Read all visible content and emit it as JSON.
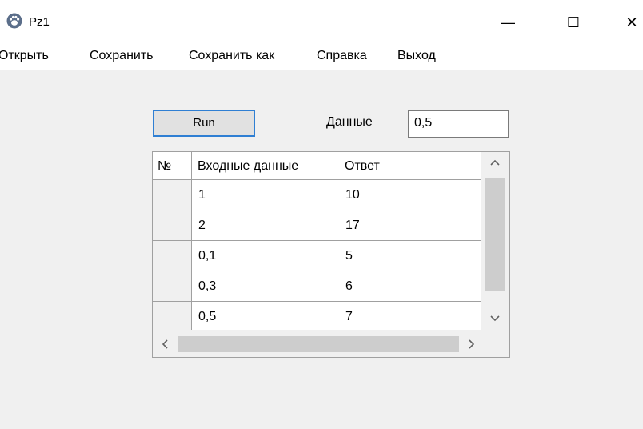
{
  "window": {
    "title": "Pz1",
    "controls": {
      "minimize": "—",
      "maximize": "☐",
      "close": "✕"
    }
  },
  "menu": {
    "items": [
      {
        "label": "Открыть"
      },
      {
        "label": "Сохранить"
      },
      {
        "label": "Сохранить как"
      },
      {
        "label": "Справка"
      },
      {
        "label": "Выход"
      }
    ]
  },
  "form": {
    "run_label": "Run",
    "data_label": "Данные",
    "data_value": "0,5"
  },
  "table": {
    "columns": [
      "№",
      "Входные данные",
      "Ответ"
    ],
    "rows": [
      {
        "n": "",
        "input": "1",
        "answer": "10"
      },
      {
        "n": "",
        "input": "2",
        "answer": "17"
      },
      {
        "n": "",
        "input": "0,1",
        "answer": "5"
      },
      {
        "n": "",
        "input": "0,3",
        "answer": "6"
      },
      {
        "n": "",
        "input": "0,5",
        "answer": "7"
      }
    ]
  },
  "icons": {
    "app": "paw-icon",
    "scroll_up": "chevron-up-icon",
    "scroll_down": "chevron-down-icon",
    "scroll_left": "chevron-left-icon",
    "scroll_right": "chevron-right-icon"
  },
  "colors": {
    "focus_border": "#2f7fd3",
    "client_bg": "#f0f0f0",
    "button_bg": "#e1e1e1"
  }
}
